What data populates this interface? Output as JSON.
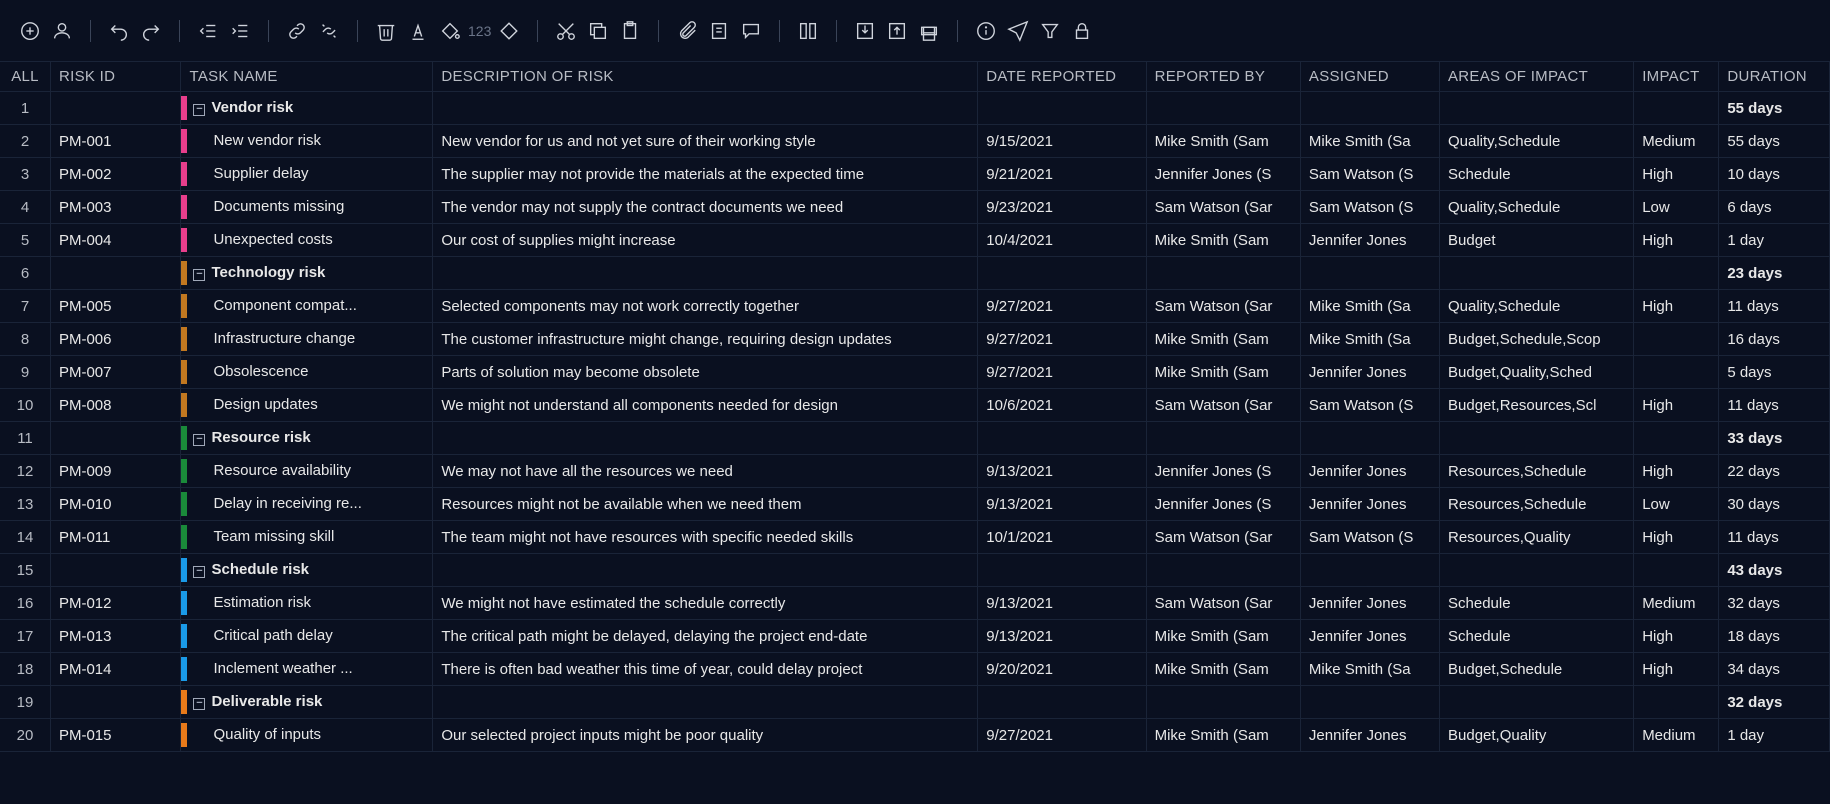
{
  "toolbar": {
    "numbers": "123"
  },
  "headers": {
    "all": "ALL",
    "risk_id": "RISK ID",
    "task_name": "TASK NAME",
    "description": "DESCRIPTION OF RISK",
    "date_reported": "DATE REPORTED",
    "reported_by": "REPORTED BY",
    "assigned": "ASSIGNED",
    "areas": "AREAS OF IMPACT",
    "impact": "IMPACT",
    "duration": "DURATION"
  },
  "rows": [
    {
      "n": "1",
      "group": true,
      "stripe": "#e83e8c",
      "task": "Vendor risk",
      "duration": "55 days"
    },
    {
      "n": "2",
      "risk": "PM-001",
      "stripe": "#e83e8c",
      "task": "New vendor risk",
      "desc": "New vendor for us and not yet sure of their working style",
      "date": "9/15/2021",
      "by": "Mike Smith (Sam",
      "assigned": "Mike Smith (Sa",
      "areas": "Quality,Schedule",
      "impact": "Medium",
      "duration": "55 days"
    },
    {
      "n": "3",
      "risk": "PM-002",
      "stripe": "#e83e8c",
      "task": "Supplier delay",
      "desc": "The supplier may not provide the materials at the expected time",
      "date": "9/21/2021",
      "by": "Jennifer Jones (S",
      "assigned": "Sam Watson (S",
      "areas": "Schedule",
      "impact": "High",
      "duration": "10 days"
    },
    {
      "n": "4",
      "risk": "PM-003",
      "stripe": "#e83e8c",
      "task": "Documents missing",
      "desc": "The vendor may not supply the contract documents we need",
      "date": "9/23/2021",
      "by": "Sam Watson (Sar",
      "assigned": "Sam Watson (S",
      "areas": "Quality,Schedule",
      "impact": "Low",
      "duration": "6 days"
    },
    {
      "n": "5",
      "risk": "PM-004",
      "stripe": "#e83e8c",
      "task": "Unexpected costs",
      "desc": "Our cost of supplies might increase",
      "date": "10/4/2021",
      "by": "Mike Smith (Sam",
      "assigned": "Jennifer Jones",
      "areas": "Budget",
      "impact": "High",
      "duration": "1 day"
    },
    {
      "n": "6",
      "group": true,
      "stripe": "#c27820",
      "task": "Technology risk",
      "duration": "23 days"
    },
    {
      "n": "7",
      "risk": "PM-005",
      "stripe": "#c27820",
      "task": "Component compat...",
      "desc": "Selected components may not work correctly together",
      "date": "9/27/2021",
      "by": "Sam Watson (Sar",
      "assigned": "Mike Smith (Sa",
      "areas": "Quality,Schedule",
      "impact": "High",
      "duration": "11 days"
    },
    {
      "n": "8",
      "risk": "PM-006",
      "stripe": "#c27820",
      "task": "Infrastructure change",
      "desc": "The customer infrastructure might change, requiring design updates",
      "date": "9/27/2021",
      "by": "Mike Smith (Sam",
      "assigned": "Mike Smith (Sa",
      "areas": "Budget,Schedule,Scop",
      "impact": "",
      "duration": "16 days"
    },
    {
      "n": "9",
      "risk": "PM-007",
      "stripe": "#c27820",
      "task": "Obsolescence",
      "desc": "Parts of solution may become obsolete",
      "date": "9/27/2021",
      "by": "Mike Smith (Sam",
      "assigned": "Jennifer Jones",
      "areas": "Budget,Quality,Sched",
      "impact": "",
      "duration": "5 days"
    },
    {
      "n": "10",
      "risk": "PM-008",
      "stripe": "#c27820",
      "task": "Design updates",
      "desc": "We might not understand all components needed for design",
      "date": "10/6/2021",
      "by": "Sam Watson (Sar",
      "assigned": "Sam Watson (S",
      "areas": "Budget,Resources,Scl",
      "impact": "High",
      "duration": "11 days"
    },
    {
      "n": "11",
      "group": true,
      "stripe": "#1a8a3a",
      "task": "Resource risk",
      "duration": "33 days"
    },
    {
      "n": "12",
      "risk": "PM-009",
      "stripe": "#1a8a3a",
      "task": "Resource availability",
      "desc": "We may not have all the resources we need",
      "date": "9/13/2021",
      "by": "Jennifer Jones (S",
      "assigned": "Jennifer Jones",
      "areas": "Resources,Schedule",
      "impact": "High",
      "duration": "22 days"
    },
    {
      "n": "13",
      "risk": "PM-010",
      "stripe": "#1a8a3a",
      "task": "Delay in receiving re...",
      "desc": "Resources might not be available when we need them",
      "date": "9/13/2021",
      "by": "Jennifer Jones (S",
      "assigned": "Jennifer Jones",
      "areas": "Resources,Schedule",
      "impact": "Low",
      "duration": "30 days"
    },
    {
      "n": "14",
      "risk": "PM-011",
      "stripe": "#1a8a3a",
      "task": "Team missing skill",
      "desc": "The team might not have resources with specific needed skills",
      "date": "10/1/2021",
      "by": "Sam Watson (Sar",
      "assigned": "Sam Watson (S",
      "areas": "Resources,Quality",
      "impact": "High",
      "duration": "11 days"
    },
    {
      "n": "15",
      "group": true,
      "stripe": "#1a9ae8",
      "task": "Schedule risk",
      "duration": "43 days"
    },
    {
      "n": "16",
      "risk": "PM-012",
      "stripe": "#1a9ae8",
      "task": "Estimation risk",
      "desc": "We might not have estimated the schedule correctly",
      "date": "9/13/2021",
      "by": "Sam Watson (Sar",
      "assigned": "Jennifer Jones",
      "areas": "Schedule",
      "impact": "Medium",
      "duration": "32 days"
    },
    {
      "n": "17",
      "risk": "PM-013",
      "stripe": "#1a9ae8",
      "task": "Critical path delay",
      "desc": "The critical path might be delayed, delaying the project end-date",
      "date": "9/13/2021",
      "by": "Mike Smith (Sam",
      "assigned": "Jennifer Jones",
      "areas": "Schedule",
      "impact": "High",
      "duration": "18 days"
    },
    {
      "n": "18",
      "risk": "PM-014",
      "stripe": "#1a9ae8",
      "task": "Inclement weather ...",
      "desc": "There is often bad weather this time of year, could delay project",
      "date": "9/20/2021",
      "by": "Mike Smith (Sam",
      "assigned": "Mike Smith (Sa",
      "areas": "Budget,Schedule",
      "impact": "High",
      "duration": "34 days"
    },
    {
      "n": "19",
      "group": true,
      "stripe": "#e87a1a",
      "task": "Deliverable risk",
      "duration": "32 days"
    },
    {
      "n": "20",
      "risk": "PM-015",
      "stripe": "#e87a1a",
      "task": "Quality of inputs",
      "desc": "Our selected project inputs might be poor quality",
      "date": "9/27/2021",
      "by": "Mike Smith (Sam",
      "assigned": "Jennifer Jones",
      "areas": "Budget,Quality",
      "impact": "Medium",
      "duration": "1 day"
    }
  ]
}
